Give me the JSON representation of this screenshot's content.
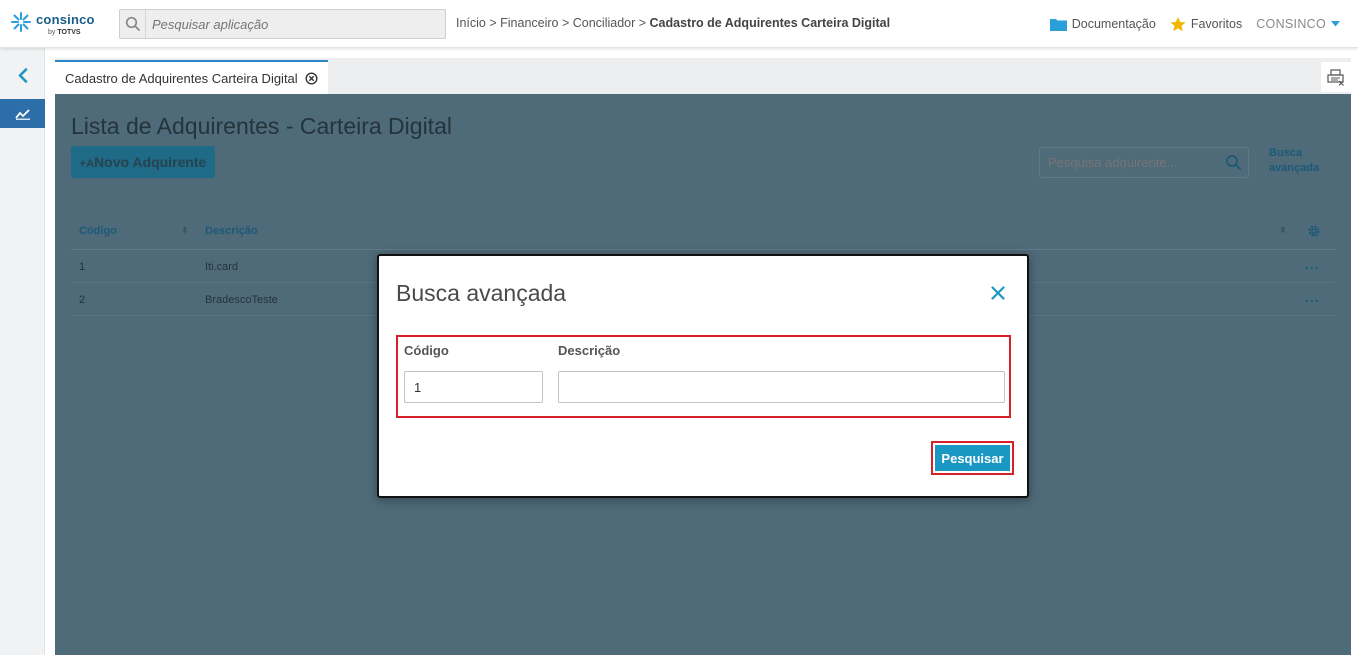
{
  "brand": {
    "name": "consinco",
    "sub_prefix": "by",
    "sub_name": "TOTVS"
  },
  "search": {
    "placeholder": "Pesquisar aplicação"
  },
  "breadcrumb": {
    "path": "Início > Financeiro > Conciliador > ",
    "current": "Cadastro de Adquirentes Carteira Digital"
  },
  "header": {
    "documentation": "Documentação",
    "favorites": "Favoritos",
    "user": "CONSINCO"
  },
  "tab": {
    "label": "Cadastro de Adquirentes Carteira Digital"
  },
  "page": {
    "title": "Lista de Adquirentes - Carteira Digital",
    "new_button_icon": "+A",
    "new_button": "Novo Adquirente",
    "search_placeholder": "Pesquisa adquirente...",
    "advanced_link_line1": "Busca",
    "advanced_link_line2": "avançada"
  },
  "table": {
    "columns": [
      "Código",
      "Descrição"
    ],
    "rows": [
      {
        "codigo": "1",
        "descricao": "Iti.card"
      },
      {
        "codigo": "2",
        "descricao": "BradescoTeste"
      }
    ],
    "row_action": "..."
  },
  "modal": {
    "title": "Busca avançada",
    "codigo_label": "Código",
    "codigo_value": "1",
    "descricao_label": "Descrição",
    "descricao_value": "",
    "search_button": "Pesquisar"
  },
  "colors": {
    "brand_blue": "#1a5e8a",
    "accent": "#1b97c4",
    "highlight_red": "#d6202a",
    "overlay": "#4f6a78"
  },
  "icons": [
    "logo-star-icon",
    "search-icon",
    "folder-icon",
    "star-icon",
    "caret-down-icon",
    "chevron-left-icon",
    "chart-icon",
    "close-circle-icon",
    "print-icon",
    "gear-icon",
    "close-icon"
  ]
}
